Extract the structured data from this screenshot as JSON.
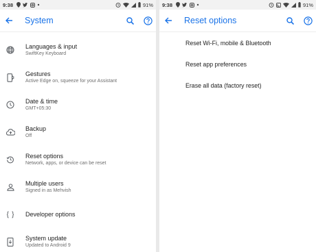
{
  "left": {
    "status": {
      "time": "9:38",
      "battery": "91%"
    },
    "title": "System",
    "items": [
      {
        "title": "Languages & input",
        "subtitle": "SwiftKey Keyboard",
        "icon": "globe-icon"
      },
      {
        "title": "Gestures",
        "subtitle": "Active Edge on, squeeze for your Assistant",
        "icon": "gesture-phone-icon"
      },
      {
        "title": "Date & time",
        "subtitle": "GMT+05:30",
        "icon": "clock-icon"
      },
      {
        "title": "Backup",
        "subtitle": "Off",
        "icon": "cloud-upload-icon"
      },
      {
        "title": "Reset options",
        "subtitle": "Network, apps, or device can be reset",
        "icon": "history-icon"
      },
      {
        "title": "Multiple users",
        "subtitle": "Signed in as Mehvish",
        "icon": "person-icon"
      },
      {
        "title": "Developer options",
        "subtitle": "",
        "icon": "braces-icon"
      },
      {
        "title": "System update",
        "subtitle": "Updated to Android 9",
        "icon": "system-update-icon"
      }
    ]
  },
  "right": {
    "status": {
      "time": "9:38",
      "battery": "91%"
    },
    "title": "Reset options",
    "items": [
      "Reset Wi-Fi, mobile & Bluetooth",
      "Reset app preferences",
      "Erase all data (factory reset)"
    ]
  },
  "colors": {
    "accent": "#1a73e8",
    "text": "#222222",
    "subtext": "#6d6d6d",
    "icon": "#5f6368"
  }
}
